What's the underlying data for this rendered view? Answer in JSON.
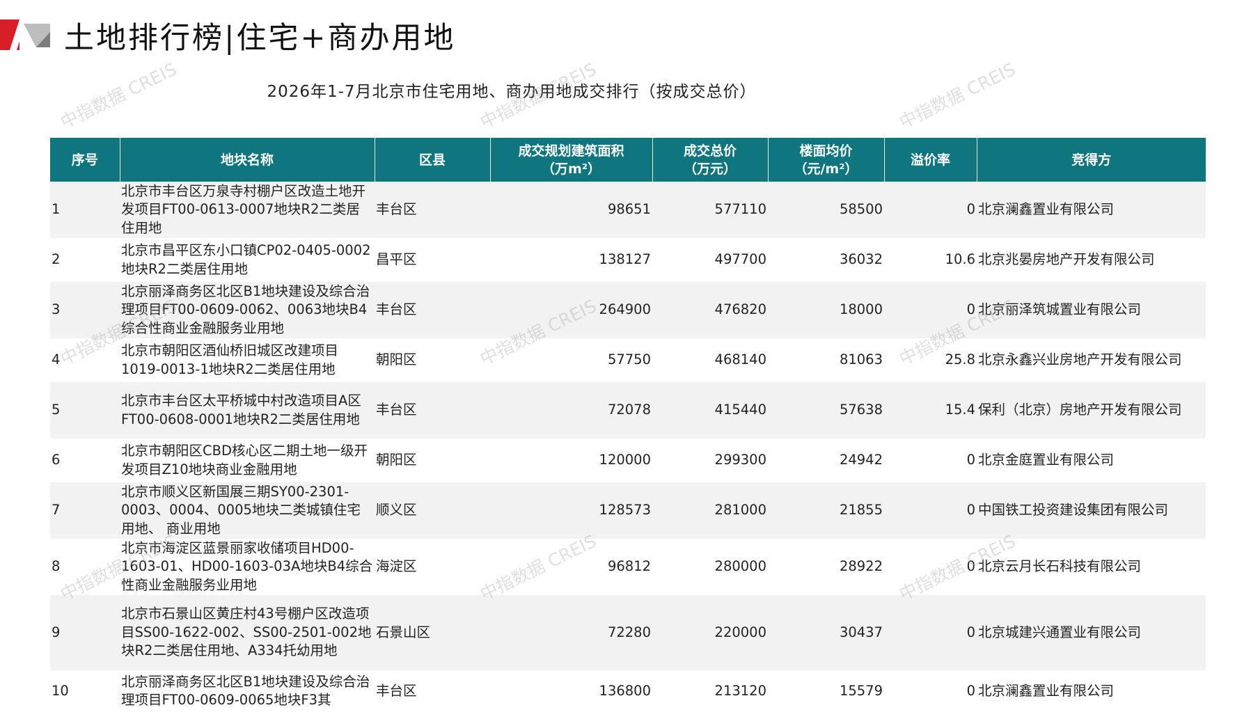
{
  "header": {
    "title": "土地排行榜|住宅+商办用地"
  },
  "table_title": "2026年1-7月北京市住宅用地、商办用地成交排行（按成交总价）",
  "watermark_text": "中指数据 CREIS",
  "colors": {
    "header_bg": "#0f7680",
    "price_text": "#c0101a",
    "logo_red": "#d81e26",
    "logo_gray": "#9a9a9a",
    "row_stripe": "#f2f2f2"
  },
  "columns": {
    "rank": "序号",
    "name": "地块名称",
    "district": "区县",
    "area_line1": "成交规划建筑面积",
    "area_line2": "（万m²）",
    "total_line1": "成交总价",
    "total_line2": "（万元）",
    "unit_line1": "楼面均价",
    "unit_line2": "（元/m²）",
    "premium": "溢价率",
    "winner": "竞得方"
  },
  "rows": [
    {
      "rank": "1",
      "name": "北京市丰台区万泉寺村棚户区改造土地开发项目FT00-0613-0007地块R2二类居住用地",
      "district": "丰台区",
      "area": "98651",
      "total": "577110",
      "unit_price": "58500",
      "premium": "0",
      "winner": "北京澜鑫置业有限公司"
    },
    {
      "rank": "2",
      "name": "北京市昌平区东小口镇CP02-0405-0002地块R2二类居住用地",
      "district": "昌平区",
      "area": "138127",
      "total": "497700",
      "unit_price": "36032",
      "premium": "10.6",
      "winner": "北京兆晏房地产开发有限公司"
    },
    {
      "rank": "3",
      "name": "北京丽泽商务区北区B1地块建设及综合治理项目FT00-0609-0062、0063地块B4综合性商业金融服务业用地",
      "district": "丰台区",
      "area": "264900",
      "total": "476820",
      "unit_price": "18000",
      "premium": "0",
      "winner": "北京丽泽筑城置业有限公司"
    },
    {
      "rank": "4",
      "name": "北京市朝阳区酒仙桥旧城区改建项目1019-0013-1地块R2二类居住用地",
      "district": "朝阳区",
      "area": "57750",
      "total": "468140",
      "unit_price": "81063",
      "premium": "25.8",
      "winner": "北京永鑫兴业房地产开发有限公司"
    },
    {
      "rank": "5",
      "name": "北京市丰台区太平桥城中村改造项目A区FT00-0608-0001地块R2二类居住用地",
      "district": "丰台区",
      "area": "72078",
      "total": "415440",
      "unit_price": "57638",
      "premium": "15.4",
      "winner": "保利（北京）房地产开发有限公司"
    },
    {
      "rank": "6",
      "name": "北京市朝阳区CBD核心区二期土地一级开发项目Z10地块商业金融用地",
      "district": "朝阳区",
      "area": "120000",
      "total": "299300",
      "unit_price": "24942",
      "premium": "0",
      "winner": "北京金庭置业有限公司"
    },
    {
      "rank": "7",
      "name": "北京市顺义区新国展三期SY00-2301-0003、0004、0005地块二类城镇住宅用地、 商业用地",
      "district": "顺义区",
      "area": "128573",
      "total": "281000",
      "unit_price": "21855",
      "premium": "0",
      "winner": "中国铁工投资建设集团有限公司"
    },
    {
      "rank": "8",
      "name": "北京市海淀区蓝景丽家收储项目HD00-1603-01、HD00-1603-03A地块B4综合性商业金融服务业用地",
      "district": "海淀区",
      "area": "96812",
      "total": "280000",
      "unit_price": "28922",
      "premium": "0",
      "winner": "北京云月长石科技有限公司"
    },
    {
      "rank": "9",
      "name": "北京市石景山区黄庄村43号棚户区改造项目SS00-1622-002、SS00-2501-002地块R2二类居住用地、A334托幼用地",
      "district": "石景山区",
      "area": "72280",
      "total": "220000",
      "unit_price": "30437",
      "premium": "0",
      "winner": "北京城建兴通置业有限公司"
    },
    {
      "rank": "10",
      "name": "北京丽泽商务区北区B1地块建设及综合治理项目FT00-0609-0065地块F3其",
      "district": "丰台区",
      "area": "136800",
      "total": "213120",
      "unit_price": "15579",
      "premium": "0",
      "winner": "北京澜鑫置业有限公司"
    }
  ]
}
